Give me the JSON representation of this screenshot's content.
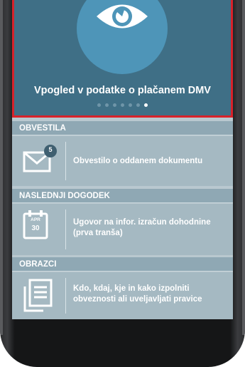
{
  "carousel": {
    "title": "Vpogled v podatke o plačanem DMV",
    "icon": "eye-icon",
    "dot_count": 7,
    "active_dot": 6
  },
  "sections": {
    "obvestila": {
      "header": "OBVESTILA",
      "badge": "5",
      "text": "Obvestilo o oddanem dokumentu",
      "icon": "envelope-icon"
    },
    "naslednji_dogodek": {
      "header": "NASLEDNJI DOGODEK",
      "calendar_month": "APR",
      "calendar_day": "30",
      "text": "Ugovor na infor. izračun dohodnine (prva tranša)",
      "icon": "calendar-icon"
    },
    "obrazci": {
      "header": "OBRAZCI",
      "text": "Kdo, kdaj, kje in kako izpolniti obveznosti ali uveljavljati pravice",
      "icon": "documents-icon"
    }
  },
  "colors": {
    "carousel_bg": "#3f6f86",
    "highlight_border": "#d8222a",
    "section_header_bg": "#8fa8b4",
    "section_row_bg": "#a5b9c2"
  }
}
